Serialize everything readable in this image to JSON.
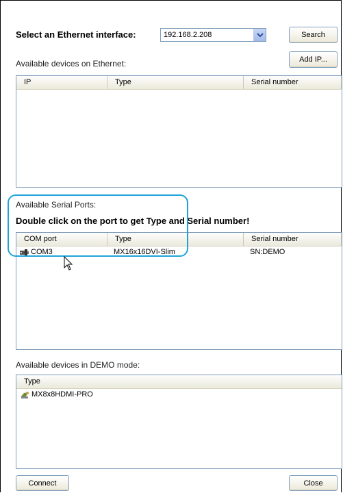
{
  "ethernet": {
    "select_label": "Select an Ethernet interface:",
    "selected_interface": "192.168.2.208",
    "search_label": "Search",
    "add_ip_label": "Add IP...",
    "available_label": "Available devices on Ethernet:",
    "columns": [
      "IP",
      "Type",
      "Serial number"
    ]
  },
  "serial": {
    "available_label": "Available Serial Ports:",
    "hint": "Double click on the port to get Type and Serial number!",
    "columns": [
      "COM port",
      "Type",
      "Serial number"
    ],
    "rows": [
      {
        "port": "COM3",
        "type": "MX16x16DVI-Slim",
        "serial": "SN:DEMO"
      }
    ]
  },
  "demo": {
    "available_label": "Available devices in DEMO mode:",
    "columns": [
      "Type"
    ],
    "rows": [
      {
        "type": "MX8x8HDMI-PRO"
      }
    ]
  },
  "footer": {
    "connect_label": "Connect",
    "close_label": "Close"
  },
  "colors": {
    "highlight": "#1ea2d8",
    "list_border": "#7f9db9"
  }
}
